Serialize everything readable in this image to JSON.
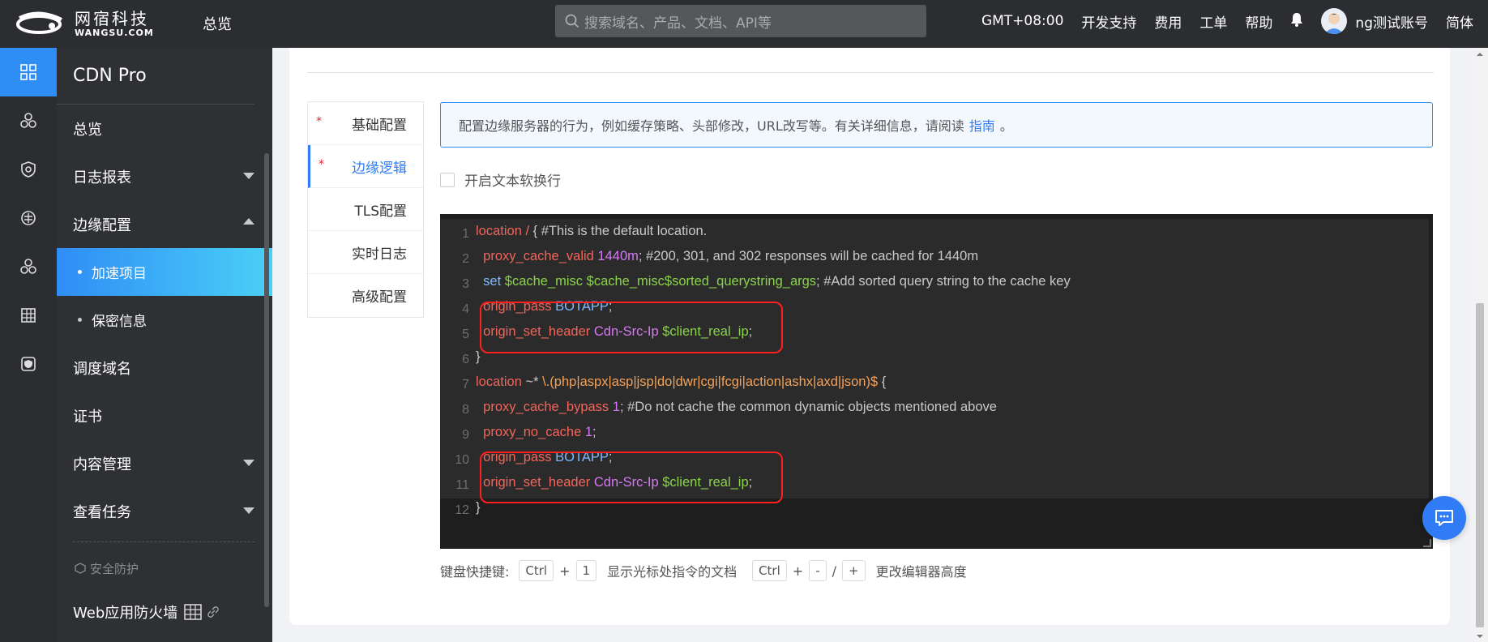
{
  "topbar": {
    "logo_cn": "网宿科技",
    "logo_en": "WANGSU.COM",
    "home": "总览",
    "search_placeholder": "搜索域名、产品、文档、API等",
    "timezone": "GMT+08:00",
    "dev_support": "开发支持",
    "billing": "费用",
    "tickets": "工单",
    "help": "帮助",
    "username": "ng测试账号",
    "language": "简体"
  },
  "rail": {
    "items": [
      "grid-icon",
      "cluster-icon",
      "shield-icon",
      "globe-icon",
      "cluster-icon",
      "table-icon",
      "shield-check-icon"
    ]
  },
  "sidebar": {
    "title": "CDN Pro",
    "items": [
      {
        "label": "总览"
      },
      {
        "label": "日志报表"
      },
      {
        "label": "边缘配置"
      },
      {
        "label": "加速项目"
      },
      {
        "label": "保密信息"
      },
      {
        "label": "调度域名"
      },
      {
        "label": "证书"
      },
      {
        "label": "内容管理"
      },
      {
        "label": "查看任务"
      }
    ],
    "section": "安全防护",
    "waf": "Web应用防火墙"
  },
  "tabs": [
    {
      "label": "基础配置",
      "required": "*"
    },
    {
      "label": "边缘逻辑",
      "required": "*"
    },
    {
      "label": "TLS配置"
    },
    {
      "label": "实时日志"
    },
    {
      "label": "高级配置"
    }
  ],
  "info": {
    "text": "配置边缘服务器的行为，例如缓存策略、头部修改，URL改写等。有关详细信息，请阅读",
    "link": "指南",
    "suffix": "。"
  },
  "wrap_label": "开启文本软换行",
  "editor": {
    "line_numbers": [
      "1",
      "2",
      "3",
      "4",
      "5",
      "6",
      "7",
      "8",
      "9",
      "10",
      "11",
      "12"
    ]
  },
  "shortcuts": {
    "label": "键盘快捷键:",
    "ctrl": "Ctrl",
    "plus": "+",
    "one": "1",
    "doc_desc": "显示光标处指令的文档",
    "minus": "-",
    "slash": "/",
    "height_desc": "更改编辑器高度"
  }
}
